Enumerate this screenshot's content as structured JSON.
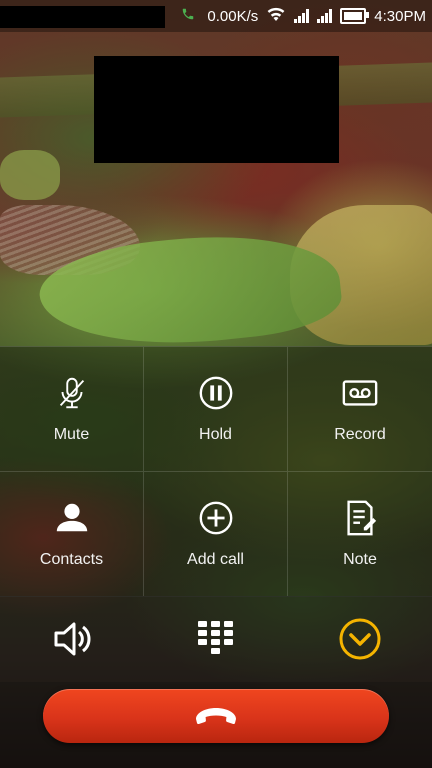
{
  "status_bar": {
    "network_speed": "0.00K/s",
    "time": "4:30PM",
    "icons": [
      "call-active-icon",
      "wifi-icon",
      "signal-icon",
      "signal-icon",
      "battery-icon"
    ]
  },
  "actions": [
    {
      "label": "Mute",
      "icon": "mic-off-icon"
    },
    {
      "label": "Hold",
      "icon": "pause-icon"
    },
    {
      "label": "Record",
      "icon": "record-icon"
    },
    {
      "label": "Contacts",
      "icon": "person-icon"
    },
    {
      "label": "Add call",
      "icon": "add-call-icon"
    },
    {
      "label": "Note",
      "icon": "note-icon"
    }
  ],
  "controls": {
    "speaker_icon": "speaker-icon",
    "dialpad_icon": "dialpad-icon",
    "collapse_icon": "chevron-down-icon",
    "accent_color": "#f5b400"
  },
  "end_call": {
    "icon": "end-call-icon",
    "color": "#d9341a"
  }
}
